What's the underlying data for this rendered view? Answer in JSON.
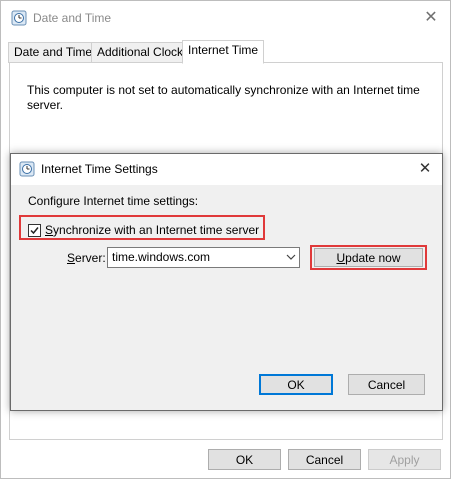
{
  "window": {
    "title": "Date and Time",
    "close_glyph": "✕"
  },
  "tabs": [
    {
      "label": "Date and Time"
    },
    {
      "label": "Additional Clocks"
    },
    {
      "label": "Internet Time",
      "active": true
    }
  ],
  "internet_time_panel": {
    "message": "This computer is not set to automatically synchronize with an Internet time server."
  },
  "footer": {
    "ok_label": "OK",
    "cancel_label": "Cancel",
    "apply_label": "Apply"
  },
  "dialog": {
    "title": "Internet Time Settings",
    "close_glyph": "✕",
    "configure_label": "Configure Internet time settings:",
    "sync_checkbox": {
      "label_accesskey": "S",
      "label_rest": "ynchronize with an Internet time server",
      "checked": true
    },
    "server_label_accesskey": "S",
    "server_label_rest": "erver:",
    "server_value": "time.windows.com",
    "update_accesskey": "U",
    "update_rest": "pdate now",
    "ok_label": "OK",
    "cancel_label": "Cancel"
  },
  "colors": {
    "highlight": "#e0393a",
    "focus_blue": "#0078d7",
    "dialog_bg": "#f0f0f0"
  },
  "icons": {
    "app": "clock-globe-icon",
    "close": "close-icon",
    "dropdown": "chevron-down-icon",
    "check": "checkmark-icon"
  }
}
